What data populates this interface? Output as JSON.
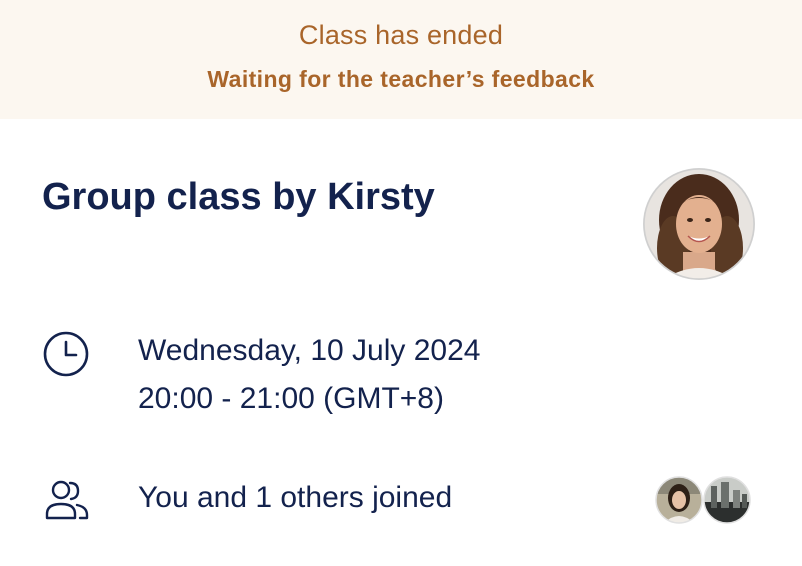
{
  "banner": {
    "title": "Class has ended",
    "subtitle": "Waiting for the teacher’s feedback",
    "background": "#fcf7f0",
    "text_color": "#a9652a"
  },
  "class": {
    "title": "Group class by Kirsty",
    "teacher_avatar_icon": "teacher-avatar-photo"
  },
  "schedule": {
    "icon": "clock-icon",
    "date": "Wednesday, 10 July 2024",
    "time": "20:00 - 21:00 (GMT+8)"
  },
  "participants": {
    "icon": "users-icon",
    "text": "You and 1 others joined",
    "avatars": [
      "participant-avatar-1",
      "participant-avatar-2"
    ]
  },
  "colors": {
    "primary_text": "#13224d"
  }
}
